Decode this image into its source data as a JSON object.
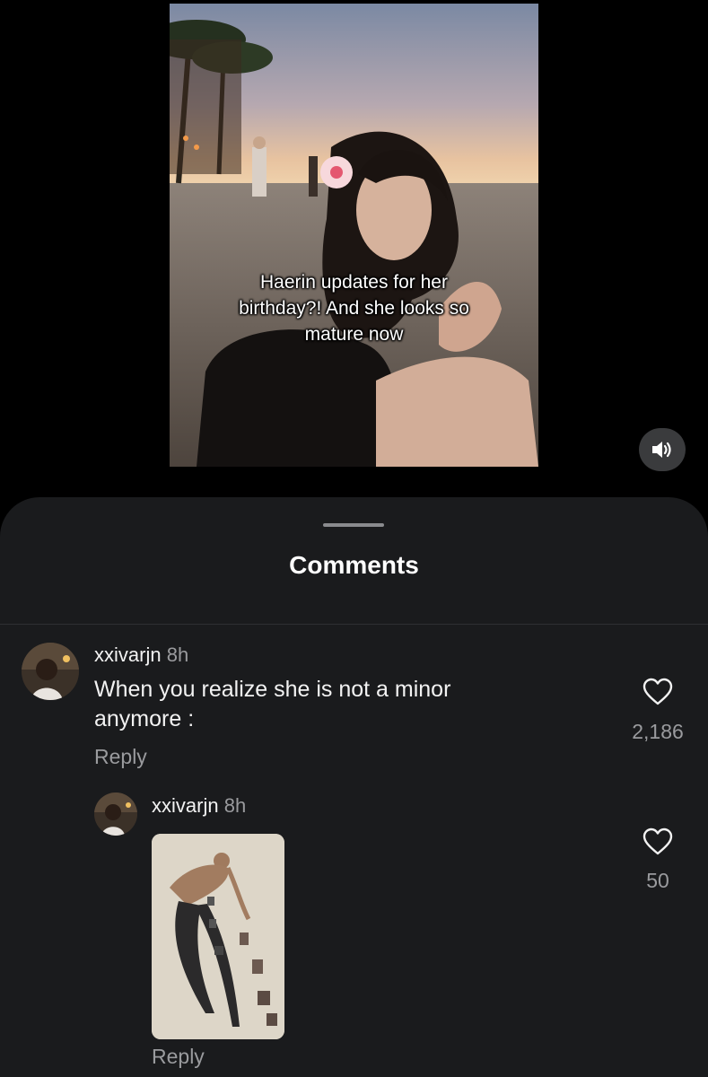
{
  "video": {
    "caption_lines": [
      "Haerin updates for her",
      "birthday?! And she looks so",
      "mature now"
    ]
  },
  "sound_button": {
    "icon": "speaker-icon"
  },
  "sheet": {
    "title": "Comments"
  },
  "comments": [
    {
      "username": "xxivarjn",
      "time": "8h",
      "text_lines": [
        "When you realize she is not a minor",
        "anymore :"
      ],
      "reply_label": "Reply",
      "like_count": "2,186"
    },
    {
      "username": "xxivarjn",
      "time": "8h",
      "reply_label": "Reply",
      "like_count": "50"
    }
  ],
  "colors": {
    "sheet_bg": "#1a1b1d",
    "text_primary": "#f2f2f2",
    "text_secondary": "#9a9b9e"
  }
}
